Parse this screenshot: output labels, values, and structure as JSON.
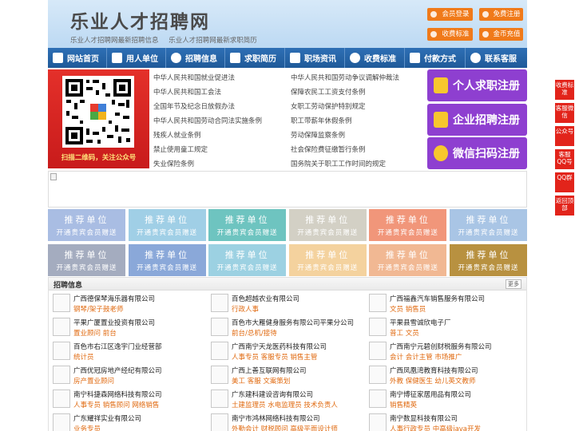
{
  "header": {
    "title": "乐业人才招聘网",
    "subtitle_left": "乐业人才招聘网最新招聘信息",
    "subtitle_right": "乐业人才招聘网最新求职简历",
    "buttons": {
      "member_login": "会员登录",
      "free_register": "免费注册",
      "fee_standard": "收费标准",
      "coin_recharge": "金币充值"
    }
  },
  "nav": {
    "items": [
      "网站首页",
      "用人单位",
      "招聘信息",
      "求职简历",
      "职场资讯",
      "收费标准",
      "付款方式",
      "联系客服"
    ]
  },
  "qr": {
    "caption": "扫描二维码，关注公众号"
  },
  "laws": [
    "中华人民共和国就业促进法",
    "中华人民共和国劳动争议调解仲裁法",
    "中华人民共和国工会法",
    "保障农民工工资支付条例",
    "全国年节及纪念日放假办法",
    "女职工劳动保护特别规定",
    "中华人民共和国劳动合同法实施条例",
    "职工带薪年休假条例",
    "残疾人就业条例",
    "劳动保障监察条例",
    "禁止使用童工规定",
    "社会保险费征缴暂行条例",
    "失业保险条例",
    "国务院关于职工工作时间的规定"
  ],
  "register": {
    "personal": "个人求职注册",
    "enterprise": "企业招聘注册",
    "wechat": "微信扫码注册"
  },
  "side": [
    "收费标准",
    "客服微信",
    "公众号",
    "客服QQ号",
    "QQ群",
    "返回顶部"
  ],
  "recommend": {
    "title": "推荐单位",
    "sub": "开通贵宾会员赠送",
    "colors": [
      "#a9bde3",
      "#a0cfe6",
      "#6ec4c0",
      "#d3d0c5",
      "#f1967a",
      "#a9c5e5",
      "#a4acbf",
      "#8aa8d9",
      "#9cd1e2",
      "#f4d29e",
      "#f1b893",
      "#b89140"
    ]
  },
  "jobs": {
    "title": "招聘信息",
    "more": "更多",
    "items": [
      {
        "company": "广西德保琴海乐器有限公司",
        "positions": "钢琴/架子鼓老师"
      },
      {
        "company": "百色超越农业有限公司",
        "positions": "行政人事"
      },
      {
        "company": "广西福鑫汽车销售服务有限公司",
        "positions": "文员 销售员"
      },
      {
        "company": "平果广厦置业投资有限公司",
        "positions": "置业顾问 前台"
      },
      {
        "company": "百色市大雁健身服务有限公司平果分公司",
        "positions": "前台/总机/接待"
      },
      {
        "company": "平果县雪诚欣电子厂",
        "positions": "普工 文员"
      },
      {
        "company": "百色市右江区逸宇门业经营部",
        "positions": "统计员"
      },
      {
        "company": "广西南宁天龙医药科技有限公司",
        "positions": "人事专员 客服专员 销售主管"
      },
      {
        "company": "广西南宁元碧创财税服务有限公司",
        "positions": "会计 会计主管 市场推广"
      },
      {
        "company": "广西优冠房地产经纪有限公司",
        "positions": "房产置业顾问"
      },
      {
        "company": "广西上善互联网有限公司",
        "positions": "美工 客服 文案策划"
      },
      {
        "company": "广西凤凰湾教育科技有限公司",
        "positions": "外教 保健医生 幼儿英文教师"
      },
      {
        "company": "南宁科捷森网络科技有限公司",
        "positions": "人事专员 销售顾问 网络销售"
      },
      {
        "company": "广东建科建设咨询有限公司",
        "positions": "土建监理员 水电监理员 技术负责人"
      },
      {
        "company": "南宁博征家居用品有限公司",
        "positions": "销售精英"
      },
      {
        "company": "广东耀祥实业有限公司",
        "positions": "业务专员"
      },
      {
        "company": "南宁市鸿林网络科技有限公司",
        "positions": "外勤会计 财税顾问 高级平面设计师"
      },
      {
        "company": "南宁数显科技有限公司",
        "positions": "人事行政专员 中高级java开发"
      }
    ]
  }
}
